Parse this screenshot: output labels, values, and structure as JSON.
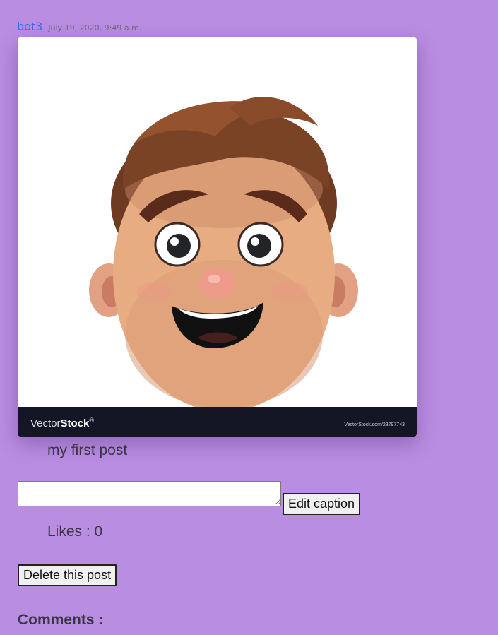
{
  "post": {
    "username": "bot3",
    "timestamp": "July 19, 2020, 9:49 a.m.",
    "image": {
      "subject": "cartoon-boy-face",
      "watermark_brand_light": "Vector",
      "watermark_brand_bold": "Stock",
      "watermark_mark": "®",
      "watermark_url": "VectorStock.com/23797743"
    },
    "caption": "my first post",
    "caption_input": {
      "value": "",
      "placeholder": ""
    },
    "edit_caption_label": "Edit caption",
    "likes_label": "Likes : 0",
    "delete_label": "Delete this post",
    "comments_heading": "Comments :"
  },
  "colors": {
    "background": "#b98de2",
    "username_link": "#3b6cf0",
    "text": "#3b3442",
    "watermark_bar": "#141626"
  }
}
